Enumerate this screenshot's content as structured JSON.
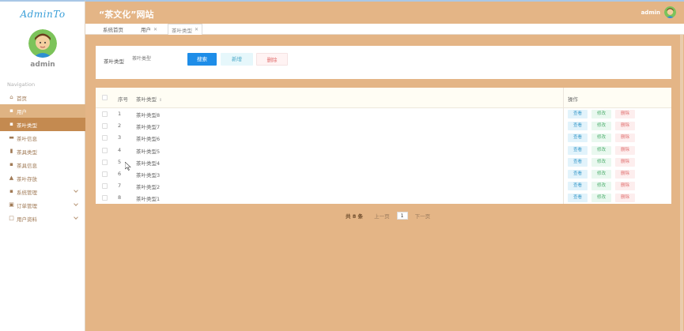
{
  "app": {
    "logo": "AdminTo",
    "site_title": "“茶文化”网站",
    "user": "admin"
  },
  "sidebar": {
    "username": "admin",
    "nav_label": "Navigation",
    "items": [
      {
        "label": "首页",
        "icon": "home-icon"
      },
      {
        "label": "用户",
        "icon": "grid-icon"
      },
      {
        "label": "茶叶类型",
        "icon": "grid-icon"
      },
      {
        "label": "茶叶信息",
        "icon": "card-icon"
      },
      {
        "label": "茶具类型",
        "icon": "bar-chart-icon"
      },
      {
        "label": "茶具信息",
        "icon": "grid-icon"
      },
      {
        "label": "茶叶存放",
        "icon": "bank-icon"
      },
      {
        "label": "系统管理",
        "icon": "grid-icon"
      },
      {
        "label": "订单管理",
        "icon": "lock-icon"
      },
      {
        "label": "用户资料",
        "icon": "document-icon"
      }
    ]
  },
  "tabs": [
    {
      "label": "系统首页"
    },
    {
      "label": "用户"
    },
    {
      "label": "茶叶类型"
    }
  ],
  "search": {
    "label": "茶叶类型",
    "placeholder": "茶叶类型",
    "search_btn": "搜索",
    "add_btn": "新增",
    "delete_btn": "删除"
  },
  "table": {
    "columns": [
      "序号",
      "茶叶类型",
      "操作"
    ],
    "rows": [
      {
        "index": "1",
        "name": "茶叶类型8"
      },
      {
        "index": "2",
        "name": "茶叶类型7"
      },
      {
        "index": "3",
        "name": "茶叶类型6"
      },
      {
        "index": "4",
        "name": "茶叶类型5"
      },
      {
        "index": "5",
        "name": "茶叶类型4"
      },
      {
        "index": "6",
        "name": "茶叶类型3"
      },
      {
        "index": "7",
        "name": "茶叶类型2"
      },
      {
        "index": "8",
        "name": "茶叶类型1"
      }
    ],
    "actions": {
      "view": "查看",
      "edit": "修改",
      "delete": "删除"
    }
  },
  "pagination": {
    "total": "共 8 条",
    "prev": "上一页",
    "current": "1",
    "next": "下一页"
  },
  "colors": {
    "background": "#e4b586",
    "active_menu": "#c48a50",
    "primary": "#1e8de8"
  }
}
